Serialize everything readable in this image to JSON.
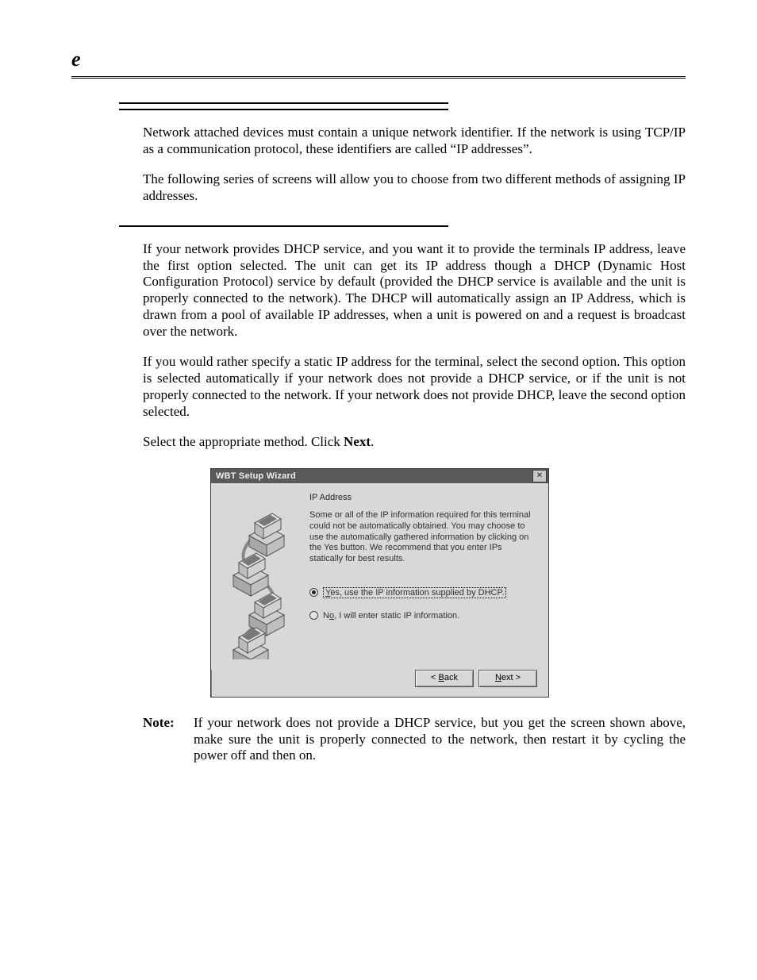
{
  "header": {
    "letter": "e"
  },
  "body": {
    "p1": "Network attached devices must contain a unique network identifier. If the network is using TCP/IP as a communication protocol, these identifiers are called “IP addresses”.",
    "p2": "The following series of screens will allow you to choose from two different methods of assigning IP addresses.",
    "p3": "If your network provides DHCP service, and you want it to provide the terminals IP address, leave the first option selected. The unit can get its IP address though a DHCP (Dynamic Host Configuration Protocol) service by default (provided the DHCP service is available and the unit is properly connected to the network). The DHCP will automatically assign an IP Address, which is drawn from a pool of available IP addresses, when a unit is powered on and a request is broadcast over the network.",
    "p4": "If you would rather specify a static IP address for the terminal, select the second option. This option is selected automatically if your network does not provide a DHCP service, or if the unit is not properly connected to the network. If your network does not provide DHCP, leave the second option selected.",
    "p5a": "Select the appropriate method. Click ",
    "p5b": "Next",
    "p5c": ".",
    "note_label": "Note:",
    "note_body": "If your network does not provide a DHCP service, but you get the screen shown above, make sure the unit is properly connected to the network, then restart it by cycling the power off and then on."
  },
  "dialog": {
    "title": "WBT Setup Wizard",
    "close_glyph": "×",
    "heading": "IP Address",
    "description": "Some or all of the IP information required for this terminal could not be automatically obtained. You may choose to use the automatically gathered information by clicking on the Yes button.  We recommend that you enter IPs statically for best results.",
    "option_yes_u": "Y",
    "option_yes_rest": "es, use the IP information supplied by DHCP.",
    "option_no_pre": "N",
    "option_no_u": "o",
    "option_no_rest": ", I will enter static IP information.",
    "back_lt": "< ",
    "back_u": "B",
    "back_rest": "ack",
    "next_u": "N",
    "next_rest": "ext >"
  }
}
